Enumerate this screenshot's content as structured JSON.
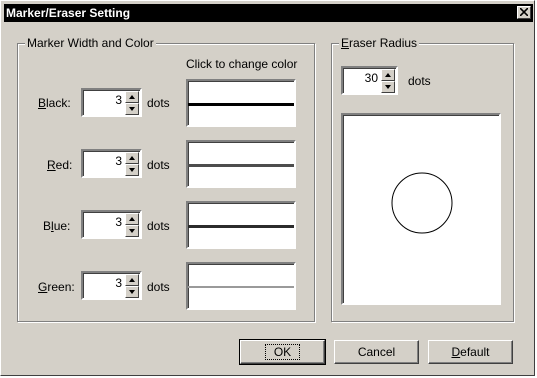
{
  "window": {
    "title": "Marker/Eraser Setting"
  },
  "marker_group": {
    "legend": "Marker Width and Color",
    "click_hint": "Click to change color",
    "rows": [
      {
        "label_mnemonic": "B",
        "label_rest": "lack:",
        "value": "3",
        "unit": "dots",
        "color": "#000000"
      },
      {
        "label_mnemonic": "R",
        "label_rest": "ed:",
        "value": "3",
        "unit": "dots",
        "color": "#4d4d4d"
      },
      {
        "label_pre": "B",
        "label_mnemonic": "l",
        "label_rest": "ue:",
        "value": "3",
        "unit": "dots",
        "color": "#2b2b2b"
      },
      {
        "label_mnemonic": "G",
        "label_rest": "reen:",
        "value": "3",
        "unit": "dots",
        "color": "#9a9a9a"
      }
    ]
  },
  "eraser_group": {
    "legend_mnemonic": "E",
    "legend_rest": "raser Radius",
    "value": "30",
    "unit": "dots"
  },
  "buttons": {
    "ok": "OK",
    "cancel": "Cancel",
    "default_mnemonic": "D",
    "default_rest": "efault"
  }
}
